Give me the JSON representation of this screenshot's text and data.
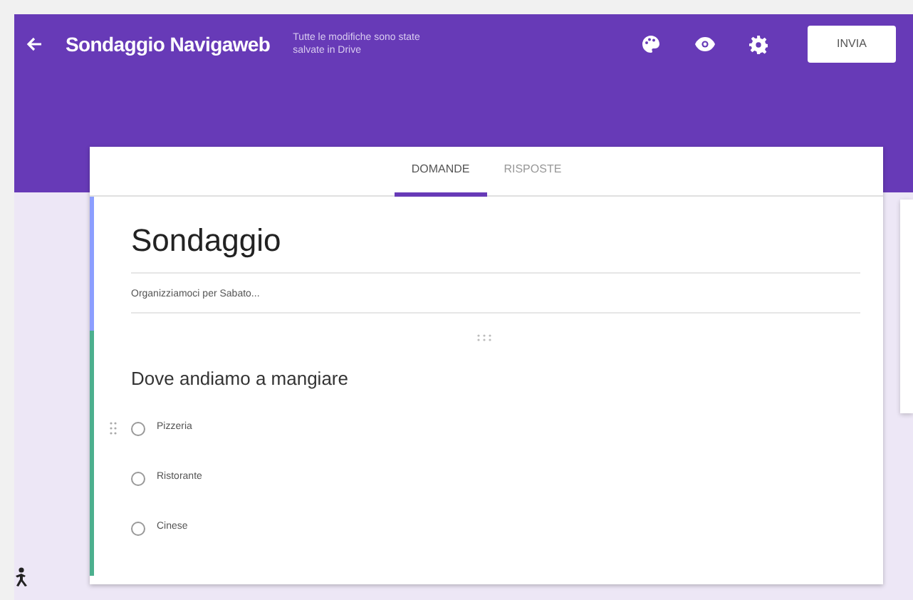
{
  "header": {
    "title": "Sondaggio Navigaweb",
    "status": "Tutte le modifiche sono state salvate in Drive",
    "send_button": "INVIA"
  },
  "tabs": [
    {
      "label": "DOMANDE",
      "selected": true
    },
    {
      "label": "RISPOSTE",
      "selected": false
    }
  ],
  "form": {
    "title": "Sondaggio",
    "description": "Organizziamoci per Sabato...",
    "question": {
      "title": "Dove andiamo a mangiare",
      "options": [
        {
          "label": "Pizzeria",
          "selected": false
        },
        {
          "label": "Ristorante",
          "selected": false
        },
        {
          "label": "Cinese",
          "selected": false
        }
      ]
    }
  }
}
